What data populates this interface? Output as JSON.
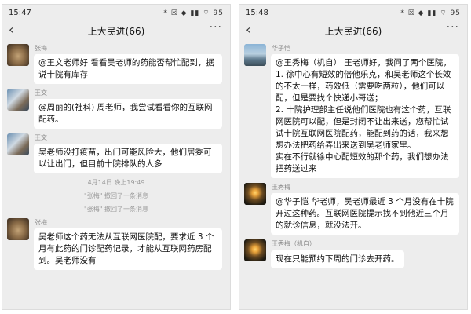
{
  "left": {
    "status_time": "15:47",
    "status_icons": "* ☒ ◆ ▮▮ ⌔ 95",
    "chat_title": "上大民进(66)",
    "messages": [
      {
        "sender": "张梅",
        "text": "@王文老师好  看看吴老师的药能否帮忙配到，据说十院有库存"
      },
      {
        "sender": "王文",
        "text": "@周丽的(社科) 周老师，我尝试看看你的互联网配药。"
      },
      {
        "sender": "王文",
        "text": "吴老师没打疫苗，出门可能风险大，他们居委可以让出门，但目前十院排队的人多"
      }
    ],
    "timestamp": "4月14日 晚上19:49",
    "recall_1": "\"张梅\" 撤回了一条消息",
    "recall_2": "\"张梅\" 撤回了一条消息",
    "last_message": {
      "sender": "张梅",
      "text": "吴老师这个药无法从互联网医院配，要求近 3 个月有此药的门诊配药记录，才能从互联网药房配到。吴老师没有"
    }
  },
  "right": {
    "status_time": "15:48",
    "status_icons": "* ☒ ◆ ▮▮ ⌔ 95",
    "chat_title": "上大民进(66)",
    "messages": [
      {
        "sender": "华子恺",
        "text": "@王秀梅（机自） 王老师好，我问了两个医院，\n1. 徐中心有短效的倍他乐克，和吴老师这个长效的不太一样，药效低（需要吃两粒），他们可以配，但是要找个快递小哥送；\n2. 十院护理部主任说他们医院也有这个药，互联网医院可以配，但是封闭不让出来送，您帮忙试试十院互联网医院配药，能配到药的话，我来想想办法把药给弄出来送到吴老师家里。\n实在不行就徐中心配短效的那个药，我们想办法把药送过来"
      },
      {
        "sender": "王秀梅",
        "text": "@华子恺  华老师，吴老师最近 3 个月没有在十院开过这种药。互联网医院提示找不到他近三个月的就诊信息，就没法开。"
      },
      {
        "sender": "王秀梅（机自）",
        "text": "现在只能预约下周的门诊去开药。"
      }
    ]
  }
}
